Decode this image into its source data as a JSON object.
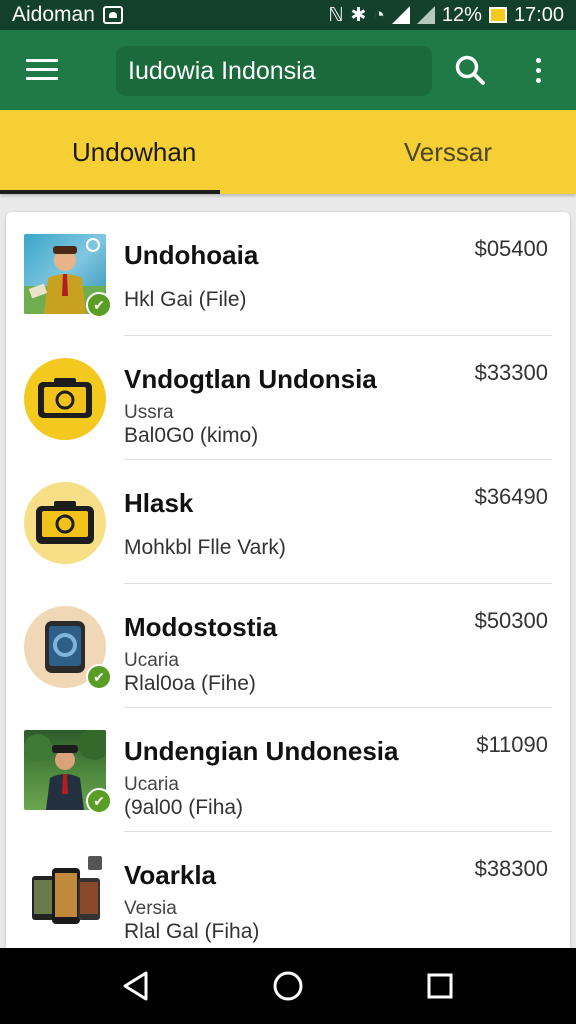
{
  "status_bar": {
    "app_name": "Aidoman",
    "battery_percent": "12%",
    "time": "17:00"
  },
  "toolbar": {
    "search_text": "Iudowia Indonsia",
    "menu_icon": "hamburger-icon",
    "search_icon": "search-icon",
    "more_icon": "more-vertical-icon"
  },
  "tabs": [
    {
      "label": "Undowhan",
      "active": true
    },
    {
      "label": "Verssar",
      "active": false
    }
  ],
  "list": [
    {
      "title": "Undohoaia",
      "line1": "",
      "line2": "Hkl Gai (File)",
      "price": "$05400",
      "thumb": "person-photo",
      "badge": true
    },
    {
      "title": "Vndogtlan Undonsia",
      "line1": "Ussra",
      "line2": "Bal0G0 (kimo)",
      "price": "$33300",
      "thumb": "yellow-device",
      "badge": false
    },
    {
      "title": "Hlask",
      "line1": "",
      "line2": "Mohkbl Flle Vark)",
      "price": "$36490",
      "thumb": "yellow-device-2",
      "badge": false
    },
    {
      "title": "Modostostia",
      "line1": "Ucaria",
      "line2": "Rlal0oa (Fihe)",
      "price": "$50300",
      "thumb": "gray-device",
      "badge": true
    },
    {
      "title": "Undengian Undonesia",
      "line1": "Ucaria",
      "line2": "(9al00 (Fiha)",
      "price": "$11090",
      "thumb": "person-photo-2",
      "badge": true
    },
    {
      "title": "Voarkla",
      "line1": "Versia",
      "line2": "Rlal Gal (Fiha)",
      "price": "$38300",
      "thumb": "phones-group",
      "badge": false
    }
  ],
  "nav": {
    "back_icon": "back-triangle-icon",
    "home_icon": "home-circle-icon",
    "recents_icon": "recents-square-icon"
  },
  "colors": {
    "toolbar": "#1f7a45",
    "status_bar": "#13402b",
    "tab_bar": "#f6cf34",
    "badge": "#5a9d24"
  }
}
